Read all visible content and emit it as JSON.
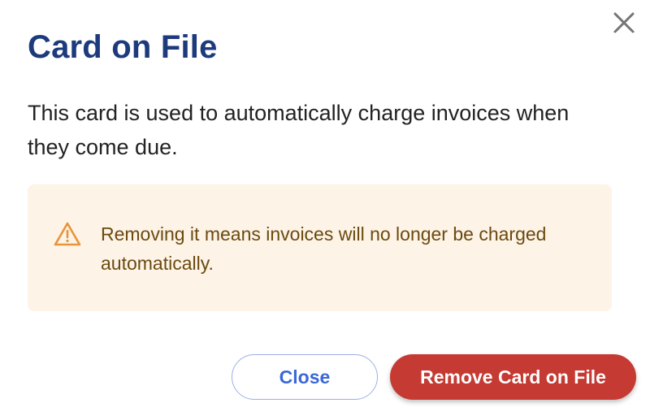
{
  "dialog": {
    "title": "Card on File",
    "description": "This card is used to automatically charge invoices when they come due.",
    "close_icon": "close-icon"
  },
  "alert": {
    "icon": "warning-icon",
    "message": "Removing it means invoices will no longer be charged automatically."
  },
  "actions": {
    "close_label": "Close",
    "remove_label": "Remove Card on File"
  },
  "colors": {
    "title": "#1c3a7c",
    "alert_background": "#fdf3e6",
    "alert_text": "#6b4a10",
    "warning_icon": "#e8943a",
    "close_button_text": "#3a68d8",
    "remove_button_background": "#c53a32"
  }
}
